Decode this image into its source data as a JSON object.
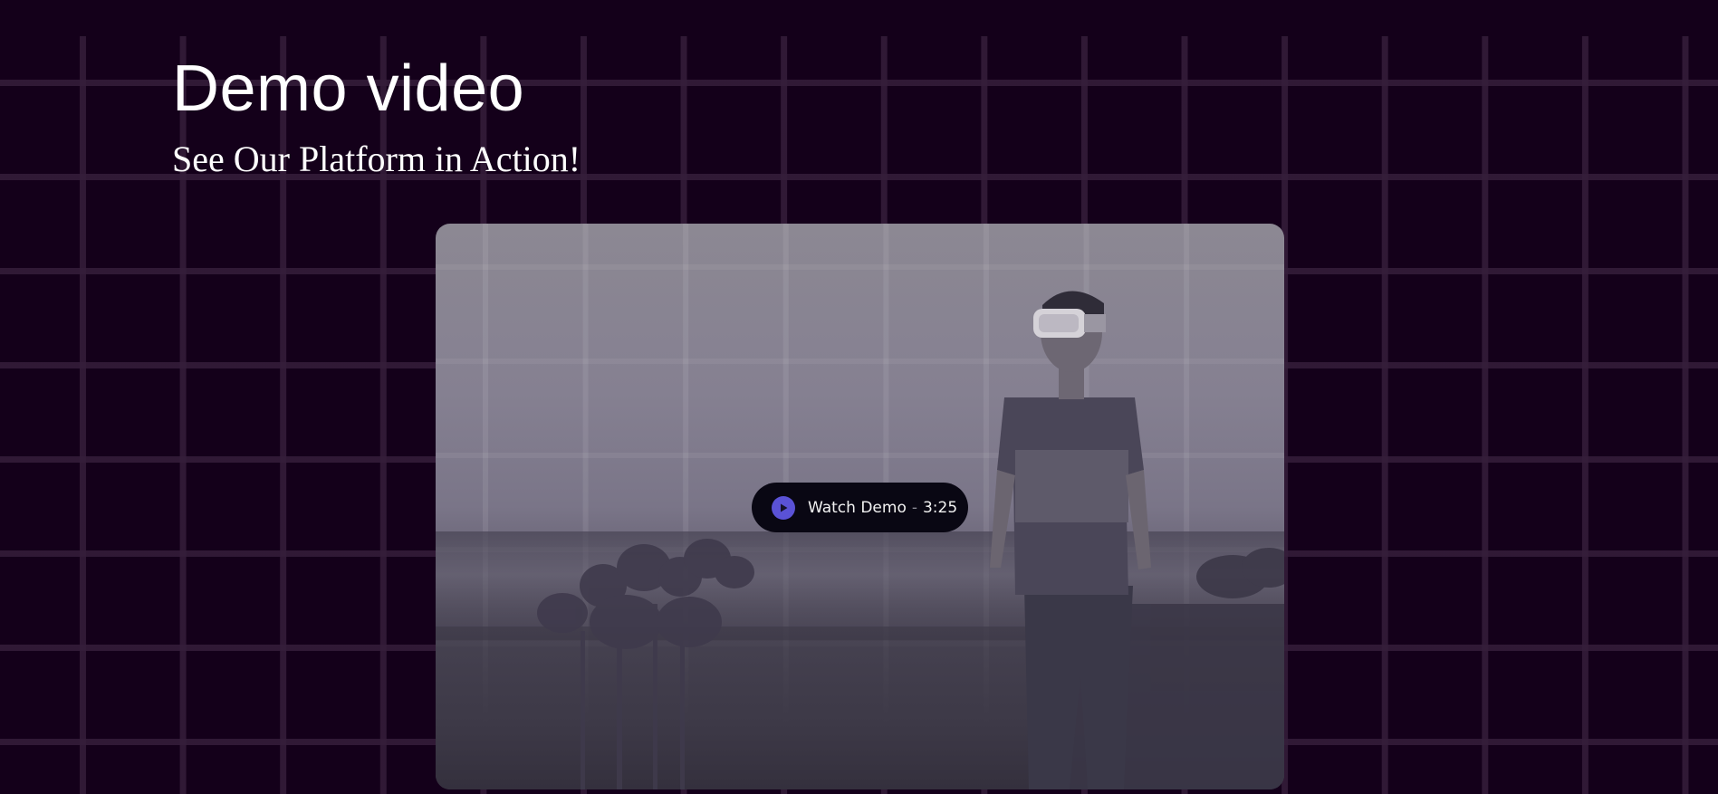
{
  "section": {
    "title": "Demo video",
    "subtitle": "See Our Platform in Action!"
  },
  "video": {
    "watch_label": "Watch Demo",
    "separator": "-",
    "duration": "3:25",
    "play_icon": "play-icon",
    "thumbnail": "person wearing VR headset walking on coastal grass"
  },
  "colors": {
    "background": "#14001a",
    "play_accent": "#5a52d6",
    "pill_background": "#090713"
  }
}
